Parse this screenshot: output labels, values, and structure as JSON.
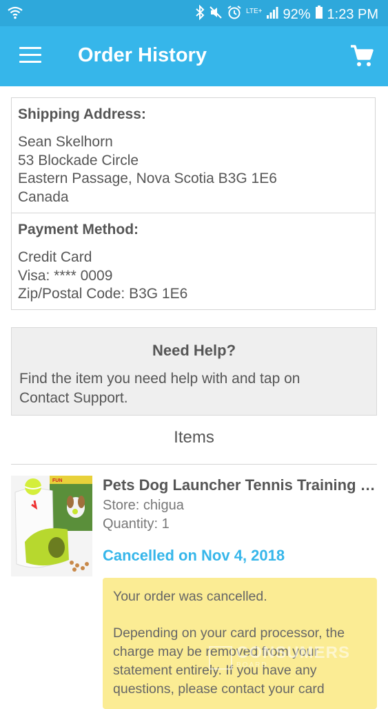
{
  "status_bar": {
    "network": "LTE+",
    "battery": "92%",
    "time": "1:23 PM"
  },
  "app_bar": {
    "title": "Order History"
  },
  "shipping": {
    "heading": "Shipping Address:",
    "lines": [
      "Sean Skelhorn",
      "53 Blockade Circle",
      "Eastern Passage, Nova Scotia B3G 1E6",
      "Canada"
    ]
  },
  "payment": {
    "heading": "Payment Method:",
    "lines": [
      "Credit Card",
      "Visa: **** 0009",
      "Zip/Postal Code: B3G 1E6"
    ]
  },
  "help": {
    "title": "Need Help?",
    "body": "Find the item you need help with and tap on Contact Support."
  },
  "items_section": {
    "heading": "Items"
  },
  "item": {
    "title": "Pets Dog Launcher Tennis Training Machine",
    "store": "Store: chigua",
    "quantity": "Quantity: 1",
    "status": "Cancelled on Nov 4, 2018",
    "thumbnail_icon": "dog-ball-launcher-image"
  },
  "notice": {
    "line1": "Your order was cancelled.",
    "line2": "Depending on your card processor, the charge may be removed from your statement entirely. If you have any questions, please contact your card"
  },
  "watermark": {
    "main": "CONSUMERS",
    "sub": "BOARD"
  },
  "colors": {
    "status_bar": "#2ea8db",
    "app_bar": "#36b6ea",
    "status_text": "#36b6ea",
    "notice_bg": "#fbec94"
  }
}
